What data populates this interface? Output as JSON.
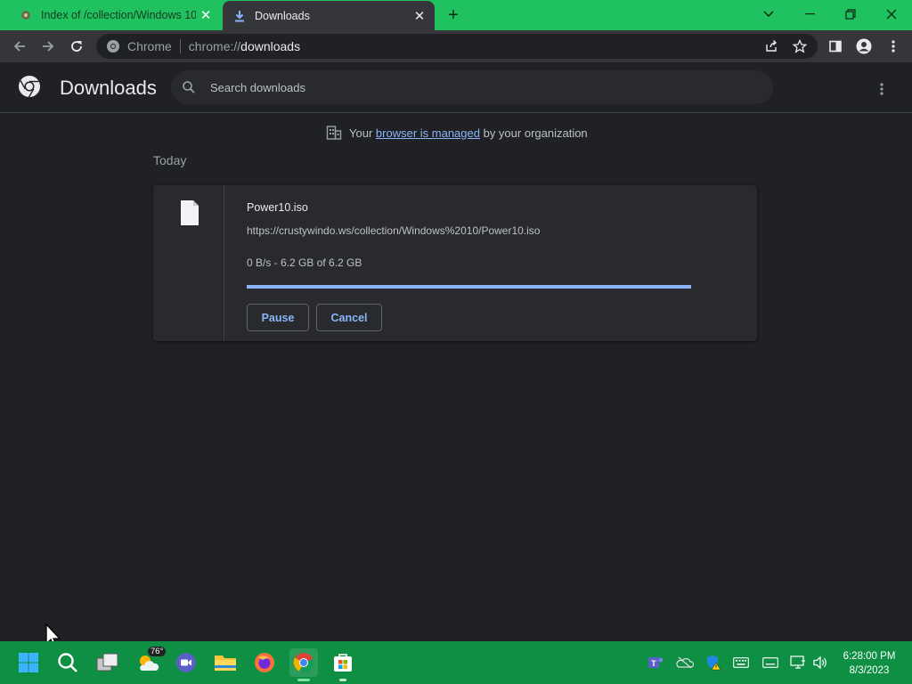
{
  "tabs": [
    {
      "title": "Index of /collection/Windows 10",
      "favicon": "page-favicon-icon",
      "active": false
    },
    {
      "title": "Downloads",
      "favicon": "download-icon",
      "active": true
    }
  ],
  "toolbar": {
    "chip": "Chrome",
    "url_scheme": "chrome://",
    "url_host": "downloads"
  },
  "page": {
    "title": "Downloads",
    "search_placeholder": "Search downloads"
  },
  "managed": {
    "prefix": "Your",
    "link": "browser is managed",
    "suffix": "by your organization"
  },
  "section_date": "Today",
  "download": {
    "file_name": "Power10.iso",
    "url": "https://crustywindo.ws/collection/Windows%2010/Power10.iso",
    "status": "0 B/s - 6.2 GB of 6.2 GB",
    "progress_fraction": 1.0,
    "pause_label": "Pause",
    "cancel_label": "Cancel"
  },
  "taskbar": {
    "weather_badge": "76°",
    "time": "6:28:00 PM",
    "date": "8/3/2023"
  },
  "colors": {
    "accent": "#8ab4f8",
    "titlebar": "#1fc25e",
    "taskbar": "#0e8f44"
  }
}
